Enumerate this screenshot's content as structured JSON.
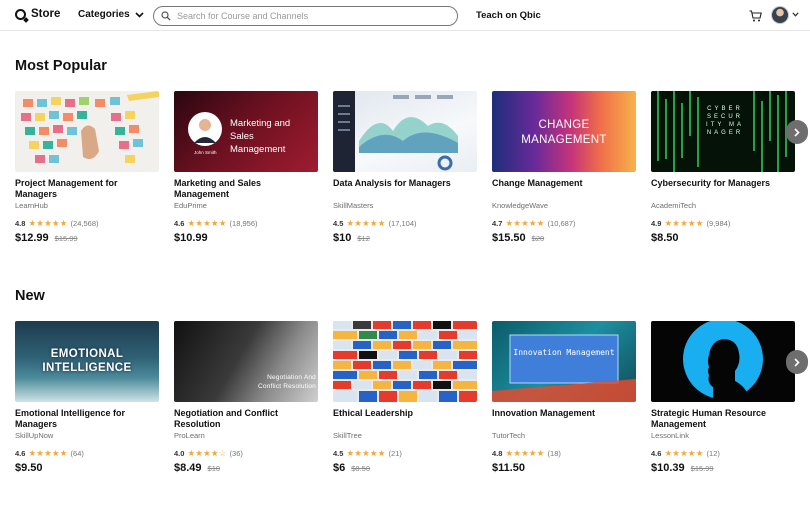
{
  "header": {
    "logo": "Store",
    "categories": "Categories",
    "search_placeholder": "Search for Course and Channels",
    "teach": "Teach on Qbic"
  },
  "sections": [
    {
      "title": "Most Popular",
      "courses": [
        {
          "title": "Project Management for Managers",
          "provider": "LearnHub",
          "rating": "4.8",
          "rating_value": 4.8,
          "count": "(24,568)",
          "price": "$12.99",
          "old_price": "$15.99",
          "thumb_text": ""
        },
        {
          "title": "Marketing and Sales Management",
          "provider": "EduPrime",
          "rating": "4.6",
          "rating_value": 4.6,
          "count": "(18,956)",
          "price": "$10.99",
          "old_price": "",
          "thumb_text": "Marketing and Sales Management",
          "thumb_caption": "John Smith"
        },
        {
          "title": "Data Analysis for Managers",
          "provider": "SkillMasters",
          "rating": "4.5",
          "rating_value": 4.5,
          "count": "(17,104)",
          "price": "$10",
          "old_price": "$12",
          "thumb_text": ""
        },
        {
          "title": "Change Management",
          "provider": "KnowledgeWave",
          "rating": "4.7",
          "rating_value": 4.7,
          "count": "(10,687)",
          "price": "$15.50",
          "old_price": "$20",
          "thumb_text": "CHANGE MANAGEMENT"
        },
        {
          "title": "Cybersecurity for Managers",
          "provider": "AcademiTech",
          "rating": "4.9",
          "rating_value": 4.9,
          "count": "(9,984)",
          "price": "$8.50",
          "old_price": "",
          "thumb_text": "CYBER SECURITY MANAGER"
        }
      ]
    },
    {
      "title": "New",
      "courses": [
        {
          "title": "Emotional Intelligence for Managers",
          "provider": "SkillUpNow",
          "rating": "4.6",
          "rating_value": 4.6,
          "count": "(64)",
          "price": "$9.50",
          "old_price": "",
          "thumb_text": "EMOTIONAL INTELLIGENCE"
        },
        {
          "title": "Negotiation and Conflict Resolution",
          "provider": "ProLearn",
          "rating": "4.0",
          "rating_value": 4.0,
          "count": "(36)",
          "price": "$8.49",
          "old_price": "$10",
          "thumb_text": "Negotiation And Conflict Resolution"
        },
        {
          "title": "Ethical Leadership",
          "provider": "SkillTree",
          "rating": "4.5",
          "rating_value": 4.5,
          "count": "(21)",
          "price": "$6",
          "old_price": "$8.50",
          "thumb_text": ""
        },
        {
          "title": "Innovation Management",
          "provider": "TutorTech",
          "rating": "4.8",
          "rating_value": 4.8,
          "count": "(18)",
          "price": "$11.50",
          "old_price": "",
          "thumb_text": "Innovation Management"
        },
        {
          "title": "Strategic Human Resource Management",
          "provider": "LessonLink",
          "rating": "4.6",
          "rating_value": 4.6,
          "count": "(12)",
          "price": "$10.39",
          "old_price": "$15.99",
          "thumb_text": ""
        }
      ]
    }
  ],
  "colors": {
    "star": "#f0a83c",
    "arrow": "#6e6e6e"
  }
}
